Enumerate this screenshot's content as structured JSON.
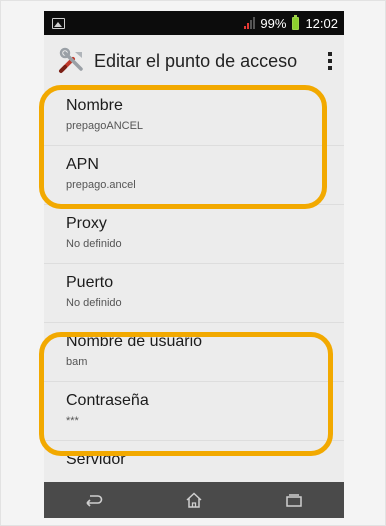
{
  "status": {
    "battery": "99%",
    "time": "12:02"
  },
  "appbar": {
    "title": "Editar el punto de acceso"
  },
  "fields": [
    {
      "label": "Nombre",
      "value": "prepagoANCEL"
    },
    {
      "label": "APN",
      "value": "prepago.ancel"
    },
    {
      "label": "Proxy",
      "value": "No definido"
    },
    {
      "label": "Puerto",
      "value": "No definido"
    },
    {
      "label": "Nombre de usuario",
      "value": "bam"
    },
    {
      "label": "Contraseña",
      "value": "***"
    },
    {
      "label": "Servidor",
      "value": ""
    }
  ],
  "colors": {
    "highlight": "#f2a900",
    "statusbar": "#0c0c0c",
    "navbar": "#4a4a4a",
    "background": "#ececec"
  },
  "icons": {
    "appbar": "tools-icon",
    "overflow": "overflow-menu-icon",
    "nav": [
      "back-icon",
      "home-icon",
      "recents-icon"
    ]
  }
}
